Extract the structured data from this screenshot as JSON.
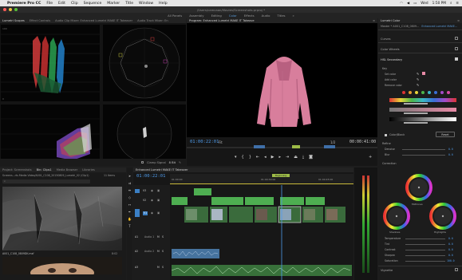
{
  "menubar": {
    "app": "Premiere Pro CC",
    "items": [
      "File",
      "Edit",
      "Clip",
      "Sequence",
      "Marker",
      "Title",
      "Window",
      "Help"
    ],
    "day": "Wed",
    "time": "1:50 PM"
  },
  "window": {
    "path": "/Users/camcaan/Movies/Screenshots.prproj *"
  },
  "workspaces": [
    "All Panels",
    "Assembly",
    "Editing",
    "Color",
    "Effects",
    "Audio",
    "Titles"
  ],
  "workspace_active": "Color",
  "scopes_panel": {
    "tabs": [
      "Lumetri Scopes",
      "Effect Controls",
      "Audio Clip Mixer: Enhanced Lumetri MAKE IT Takeover",
      "Audio Track Mixer: En"
    ],
    "clamp_label": "Clamp Signal",
    "bits": "8 Bit"
  },
  "program_monitor": {
    "title": "Program: Enhanced Lumetri MAKE IT Takeove",
    "timecode": "01:00:22:01",
    "fit": "Fit",
    "ratio": "1/2",
    "duration": "00:00:41:00"
  },
  "project_panel": {
    "tabs": [
      "Project: Screenshots",
      "Bin: Clips1",
      "Media Browser",
      "Libraries"
    ],
    "path": "Screens...rts Media Video/A001_C108_20150809_Lumetri_02 (Clip1)",
    "count": "11 Items",
    "clip_name": "A001_C108_0809DK.mxf",
    "clip_duration": "8:02"
  },
  "timeline": {
    "tab": "Enhanced Lumetri MAKE IT Takeover",
    "timecode": "01:00:22:01",
    "ruler": [
      "01:00:00",
      "01:00:30:00",
      "01:00:45:00"
    ],
    "video_tracks": [
      "V3",
      "V2",
      "V1"
    ],
    "audio_tracks": [
      "A1",
      "A2",
      "A3"
    ],
    "audio_label_1": "Audio 1",
    "audio_label_2": "Audio 2",
    "marker_label": "Beginning"
  },
  "lumetri": {
    "tab": "Lumetri Color",
    "master": "Master * A001_C108_0809...",
    "clip": "Enhanced Lumetri MAKE...",
    "sections": {
      "curves": "Curves",
      "wheels": "Color Wheels",
      "hsl": "HSL Secondary",
      "key": "Key",
      "set_color": "Set color",
      "add_color": "Add color",
      "remove_color": "Remove color",
      "color_black": "Color/Black",
      "reset": "Reset",
      "refine": "Refine",
      "denoise": "Denoise",
      "blur": "Blur",
      "correction": "Correction",
      "midtones": "Midtones",
      "shadows": "Shadows",
      "highlights": "Highlights",
      "temperature": "Temperature",
      "tint": "Tint",
      "contrast": "Contrast",
      "sharpen": "Sharpen",
      "saturation": "Saturation",
      "vignette": "Vignette"
    },
    "values": {
      "denoise": "0.0",
      "blur": "0.0",
      "temperature": "0.0",
      "tint": "0.0",
      "contrast": "0.0",
      "sharpen": "0.0",
      "saturation": "100.0"
    }
  },
  "colors": {
    "accent": "#4f9ae9",
    "video_clip": "#4eae51",
    "audio_clip": "#5b9bd9",
    "playhead": "#4f9ae9"
  }
}
